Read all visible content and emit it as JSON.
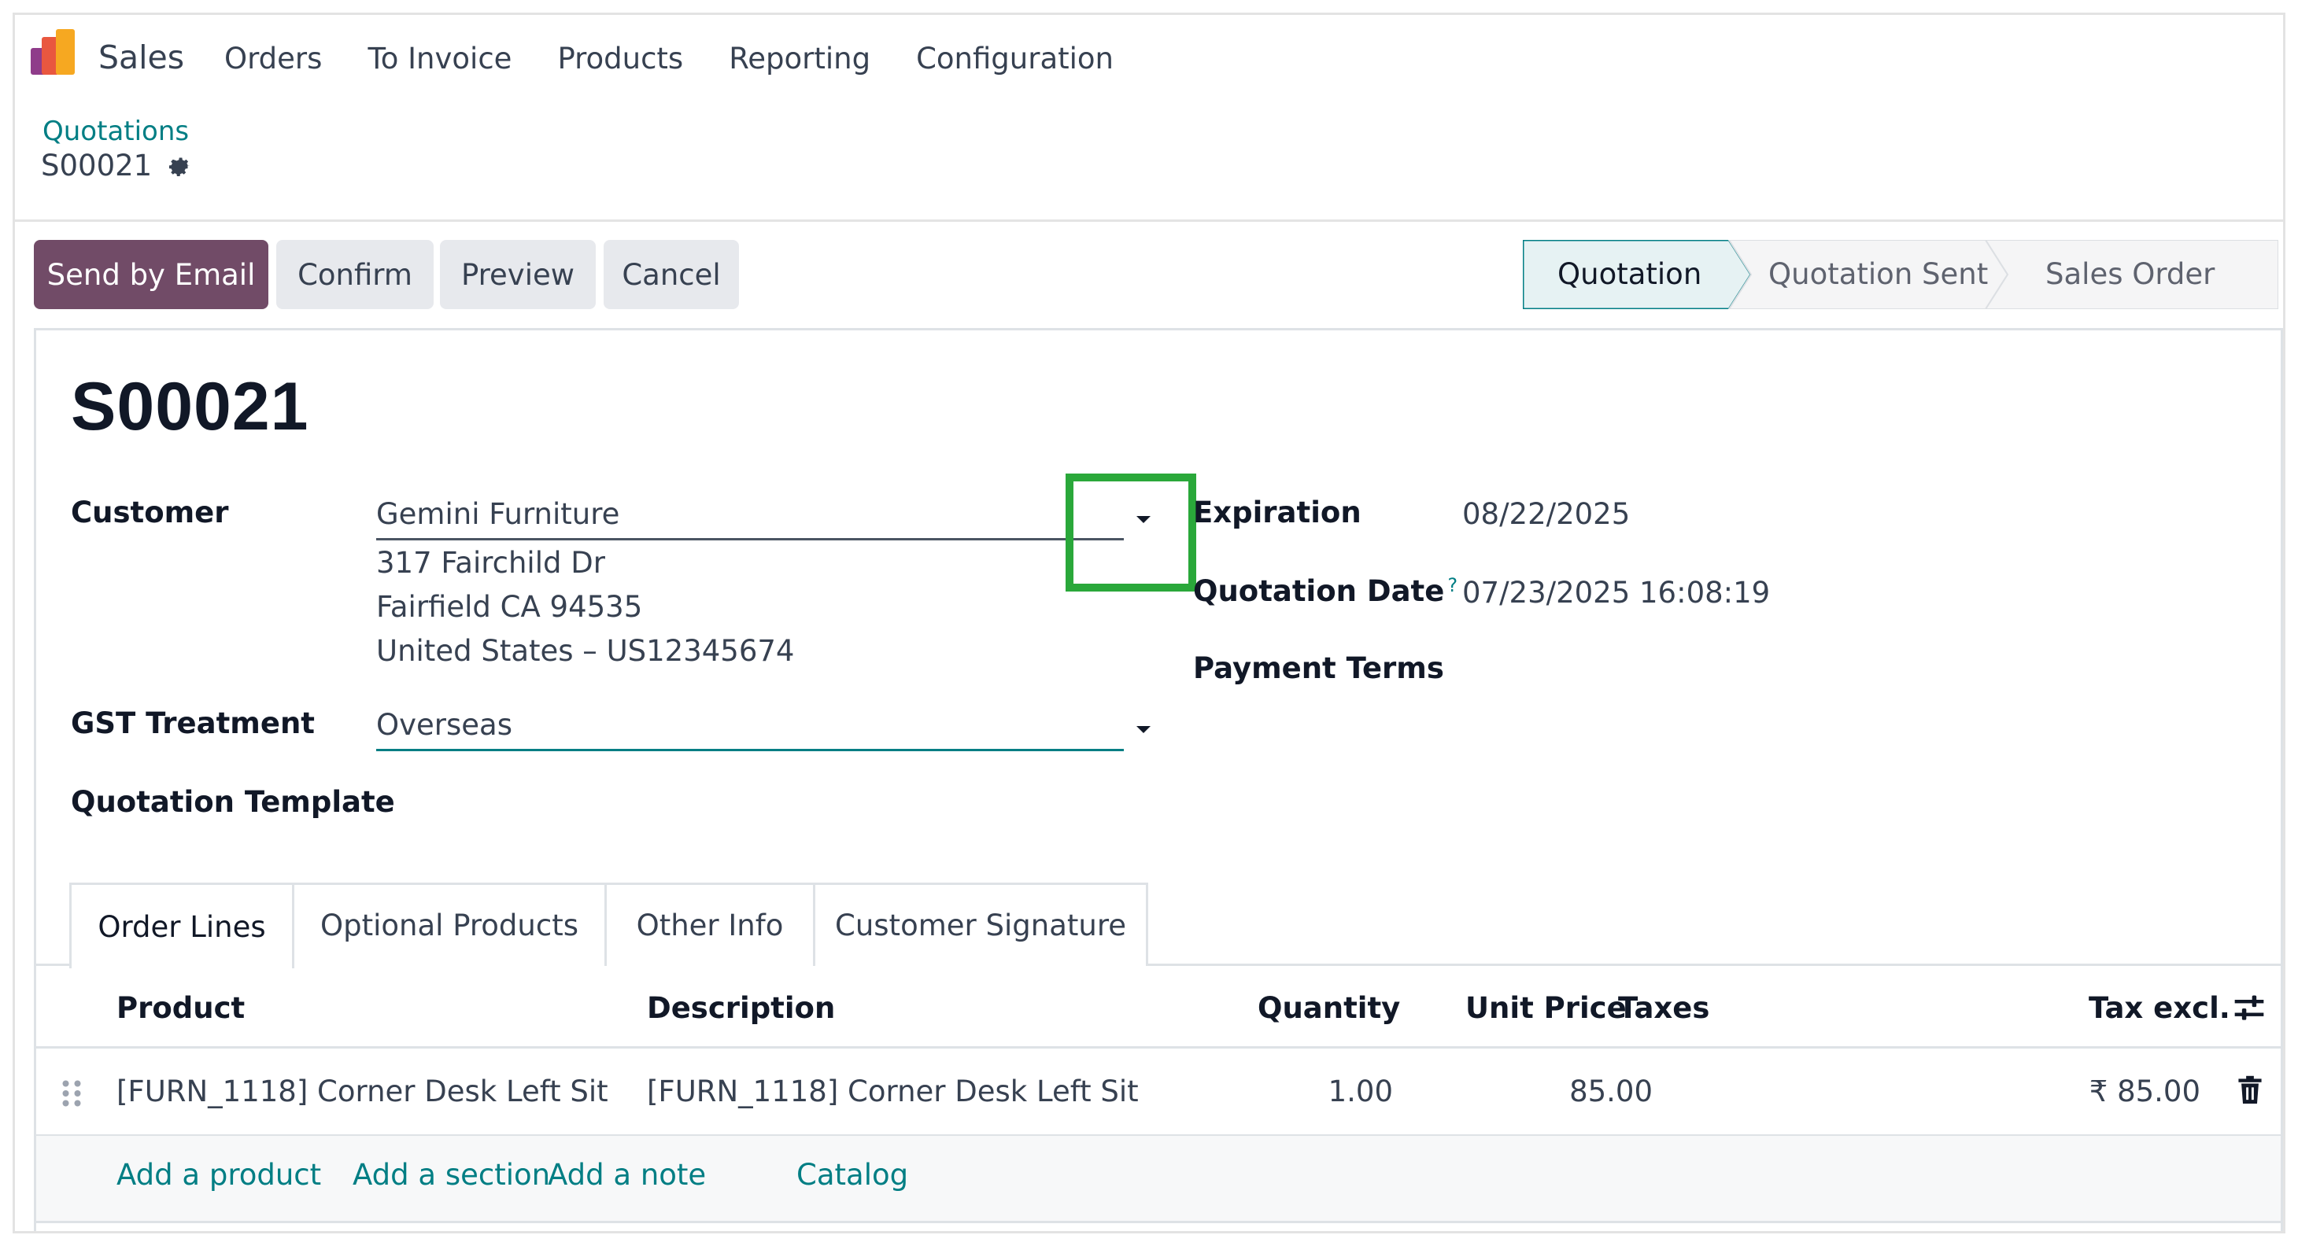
{
  "app": {
    "name": "Sales",
    "menu": [
      "Orders",
      "To Invoice",
      "Products",
      "Reporting",
      "Configuration"
    ]
  },
  "breadcrumb": {
    "parent": "Quotations",
    "current": "S00021"
  },
  "actions": {
    "send_by_email": "Send by Email",
    "confirm": "Confirm",
    "preview": "Preview",
    "cancel": "Cancel"
  },
  "status": {
    "stages": [
      "Quotation",
      "Quotation Sent",
      "Sales Order"
    ],
    "active": "Quotation"
  },
  "form": {
    "order_name": "S00021",
    "customer_label": "Customer",
    "customer_value": "Gemini Furniture",
    "address_line1": "317 Fairchild Dr",
    "address_line2": "Fairfield CA 94535",
    "address_line3": "United States – US12345674",
    "gst_label": "GST Treatment",
    "gst_value": "Overseas",
    "template_label": "Quotation Template",
    "expiration_label": "Expiration",
    "expiration_value": "08/22/2025",
    "quotation_date_label": "Quotation Date",
    "quotation_date_help": "?",
    "quotation_date_value": "07/23/2025 16:08:19",
    "payment_terms_label": "Payment Terms"
  },
  "tabs": [
    "Order Lines",
    "Optional Products",
    "Other Info",
    "Customer Signature"
  ],
  "order_lines": {
    "columns": {
      "product": "Product",
      "description": "Description",
      "quantity": "Quantity",
      "unit_price": "Unit Price",
      "taxes": "Taxes",
      "tax_excl": "Tax excl."
    },
    "rows": [
      {
        "product": "[FURN_1118] Corner Desk Left Sit",
        "description": "[FURN_1118] Corner Desk Left Sit",
        "quantity": "1.00",
        "unit_price": "85.00",
        "taxes": "",
        "tax_excl": "₹ 85.00"
      }
    ],
    "footer": {
      "add_product": "Add a product",
      "add_section": "Add a section",
      "add_note": "Add a note",
      "catalog": "Catalog"
    }
  },
  "colors": {
    "primary": "#714b67",
    "link": "#017e84",
    "highlight": "#2aa83a"
  },
  "icons": [
    "app-logo-icon",
    "gear-icon",
    "chevron-down-icon",
    "help-icon",
    "drag-handle-icon",
    "trash-icon",
    "column-settings-icon"
  ]
}
